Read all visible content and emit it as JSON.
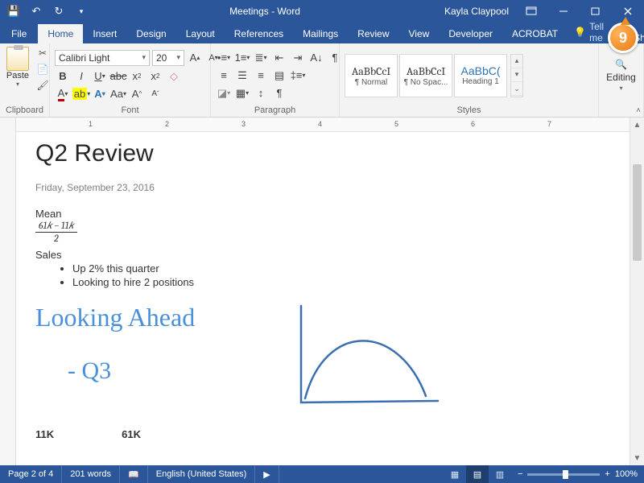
{
  "title": "Meetings - Word",
  "user": "Kayla Claypool",
  "callout": "9",
  "tabs": {
    "file": "File",
    "home": "Home",
    "insert": "Insert",
    "design": "Design",
    "layout": "Layout",
    "references": "References",
    "mailings": "Mailings",
    "review": "Review",
    "view": "View",
    "developer": "Developer",
    "acrobat": "ACROBAT",
    "tellme": "Tell me",
    "share": "Share"
  },
  "ribbon": {
    "clipboard": {
      "label": "Clipboard",
      "paste": "Paste"
    },
    "font": {
      "label": "Font",
      "name": "Calibri Light",
      "size": "20"
    },
    "paragraph": {
      "label": "Paragraph"
    },
    "styles": {
      "label": "Styles",
      "items": [
        {
          "preview": "AaBbCcI",
          "name": "¶ Normal"
        },
        {
          "preview": "AaBbCcI",
          "name": "¶ No Spac..."
        },
        {
          "preview": "AaBbC(",
          "name": "Heading 1"
        }
      ]
    },
    "editing": {
      "label": "Editing"
    }
  },
  "doc": {
    "heading": "Q2 Review",
    "date": "Friday, September 23, 2016",
    "mean_label": "Mean",
    "frac_top": "61𝑘 − 11𝑘",
    "frac_bot": "2",
    "sales_label": "Sales",
    "bullets": [
      "Up 2% this quarter",
      "Looking to hire 2 positions"
    ],
    "ink1": "Looking Ahead",
    "ink2": "- Q3",
    "vals": [
      "11K",
      "61K"
    ]
  },
  "status": {
    "page": "Page 2 of 4",
    "words": "201 words",
    "lang": "English (United States)",
    "zoom": "100%"
  },
  "ruler_marks": [
    "1",
    "2",
    "3",
    "4",
    "5",
    "6",
    "7"
  ]
}
